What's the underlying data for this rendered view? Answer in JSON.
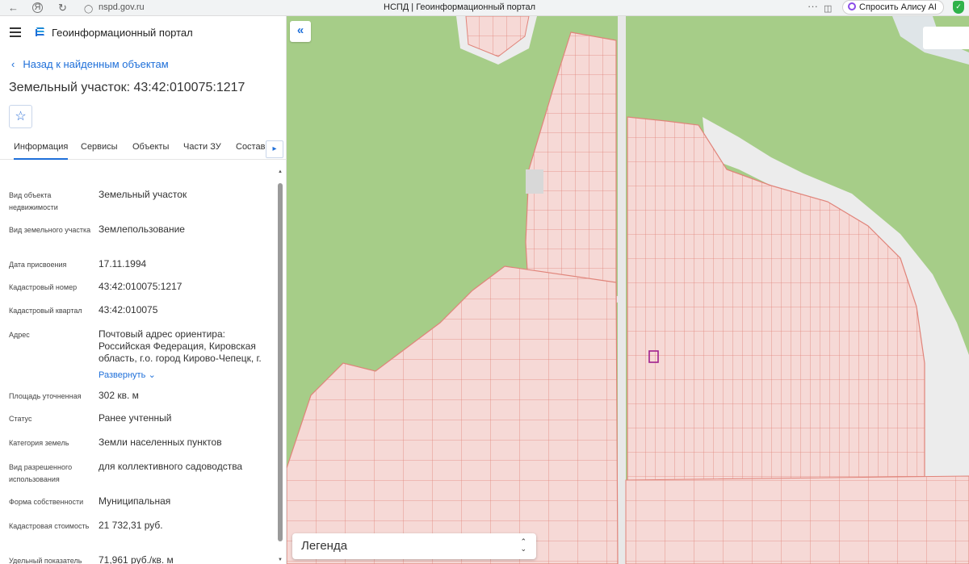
{
  "browser": {
    "url": "nspd.gov.ru",
    "title": "НСПД | Геоинформационный портал",
    "alice_label": "Спросить Алису AI"
  },
  "app": {
    "title": "Геоинформационный портал"
  },
  "nav": {
    "back_label": "Назад к найденным объектам"
  },
  "object": {
    "title": "Земельный участок: 43:42:010075:1217"
  },
  "tabs": [
    "Информация",
    "Сервисы",
    "Объекты",
    "Части ЗУ",
    "Состав"
  ],
  "fields": [
    {
      "label": "Вид объекта недвижимости",
      "value": "Земельный участок"
    },
    {
      "label": "Вид земельного участка",
      "value": "Землепользование"
    },
    {
      "label": "Дата присвоения",
      "value": "17.11.1994"
    },
    {
      "label": "Кадастровый номер",
      "value": "43:42:010075:1217"
    },
    {
      "label": "Кадастровый квартал",
      "value": "43:42:010075"
    },
    {
      "label": "Адрес",
      "value": "Почтовый адрес ориентира: Российская Федерация, Кировская область, г.о. город Кирово-Чепецк, г.",
      "expand": "Развернуть"
    },
    {
      "label": "Площадь уточненная",
      "value": "302 кв. м"
    },
    {
      "label": "Статус",
      "value": "Ранее учтенный"
    },
    {
      "label": "Категория земель",
      "value": "Земли населенных пунктов"
    },
    {
      "label": "Вид разрешенного использования",
      "value": "для коллективного садоводства"
    },
    {
      "label": "Форма собственности",
      "value": "Муниципальная"
    },
    {
      "label": "Кадастровая стоимость",
      "value": "21 732,31 руб."
    },
    {
      "label": "Удельный показатель кадастровой",
      "value": "71,961 руб./кв. м"
    }
  ],
  "map": {
    "legend_label": "Легенда"
  },
  "colors": {
    "accent": "#1e6fd9",
    "map_green": "#a6cd88",
    "parcel_fill": "#f6d9d6",
    "parcel_stroke": "#e0847a",
    "selected_parcel": "#a0208e"
  }
}
